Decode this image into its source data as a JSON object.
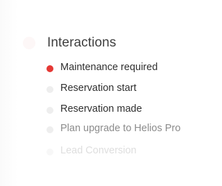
{
  "section": {
    "title": "Interactions"
  },
  "items": [
    {
      "label": "Maintenance required",
      "state": "active"
    },
    {
      "label": "Reservation start",
      "state": "normal"
    },
    {
      "label": "Reservation made",
      "state": "normal"
    },
    {
      "label": "Plan upgrade to Helios Pro",
      "state": "dim"
    },
    {
      "label": "Lead Conversion",
      "state": "faded"
    }
  ],
  "colors": {
    "active_dot": "#e53935",
    "inactive_dot": "#eeeeee",
    "title_text": "#3e3e3e",
    "item_text": "#2f2f2f",
    "dim_text": "#8b8b8b",
    "faded_text": "#dedede"
  }
}
